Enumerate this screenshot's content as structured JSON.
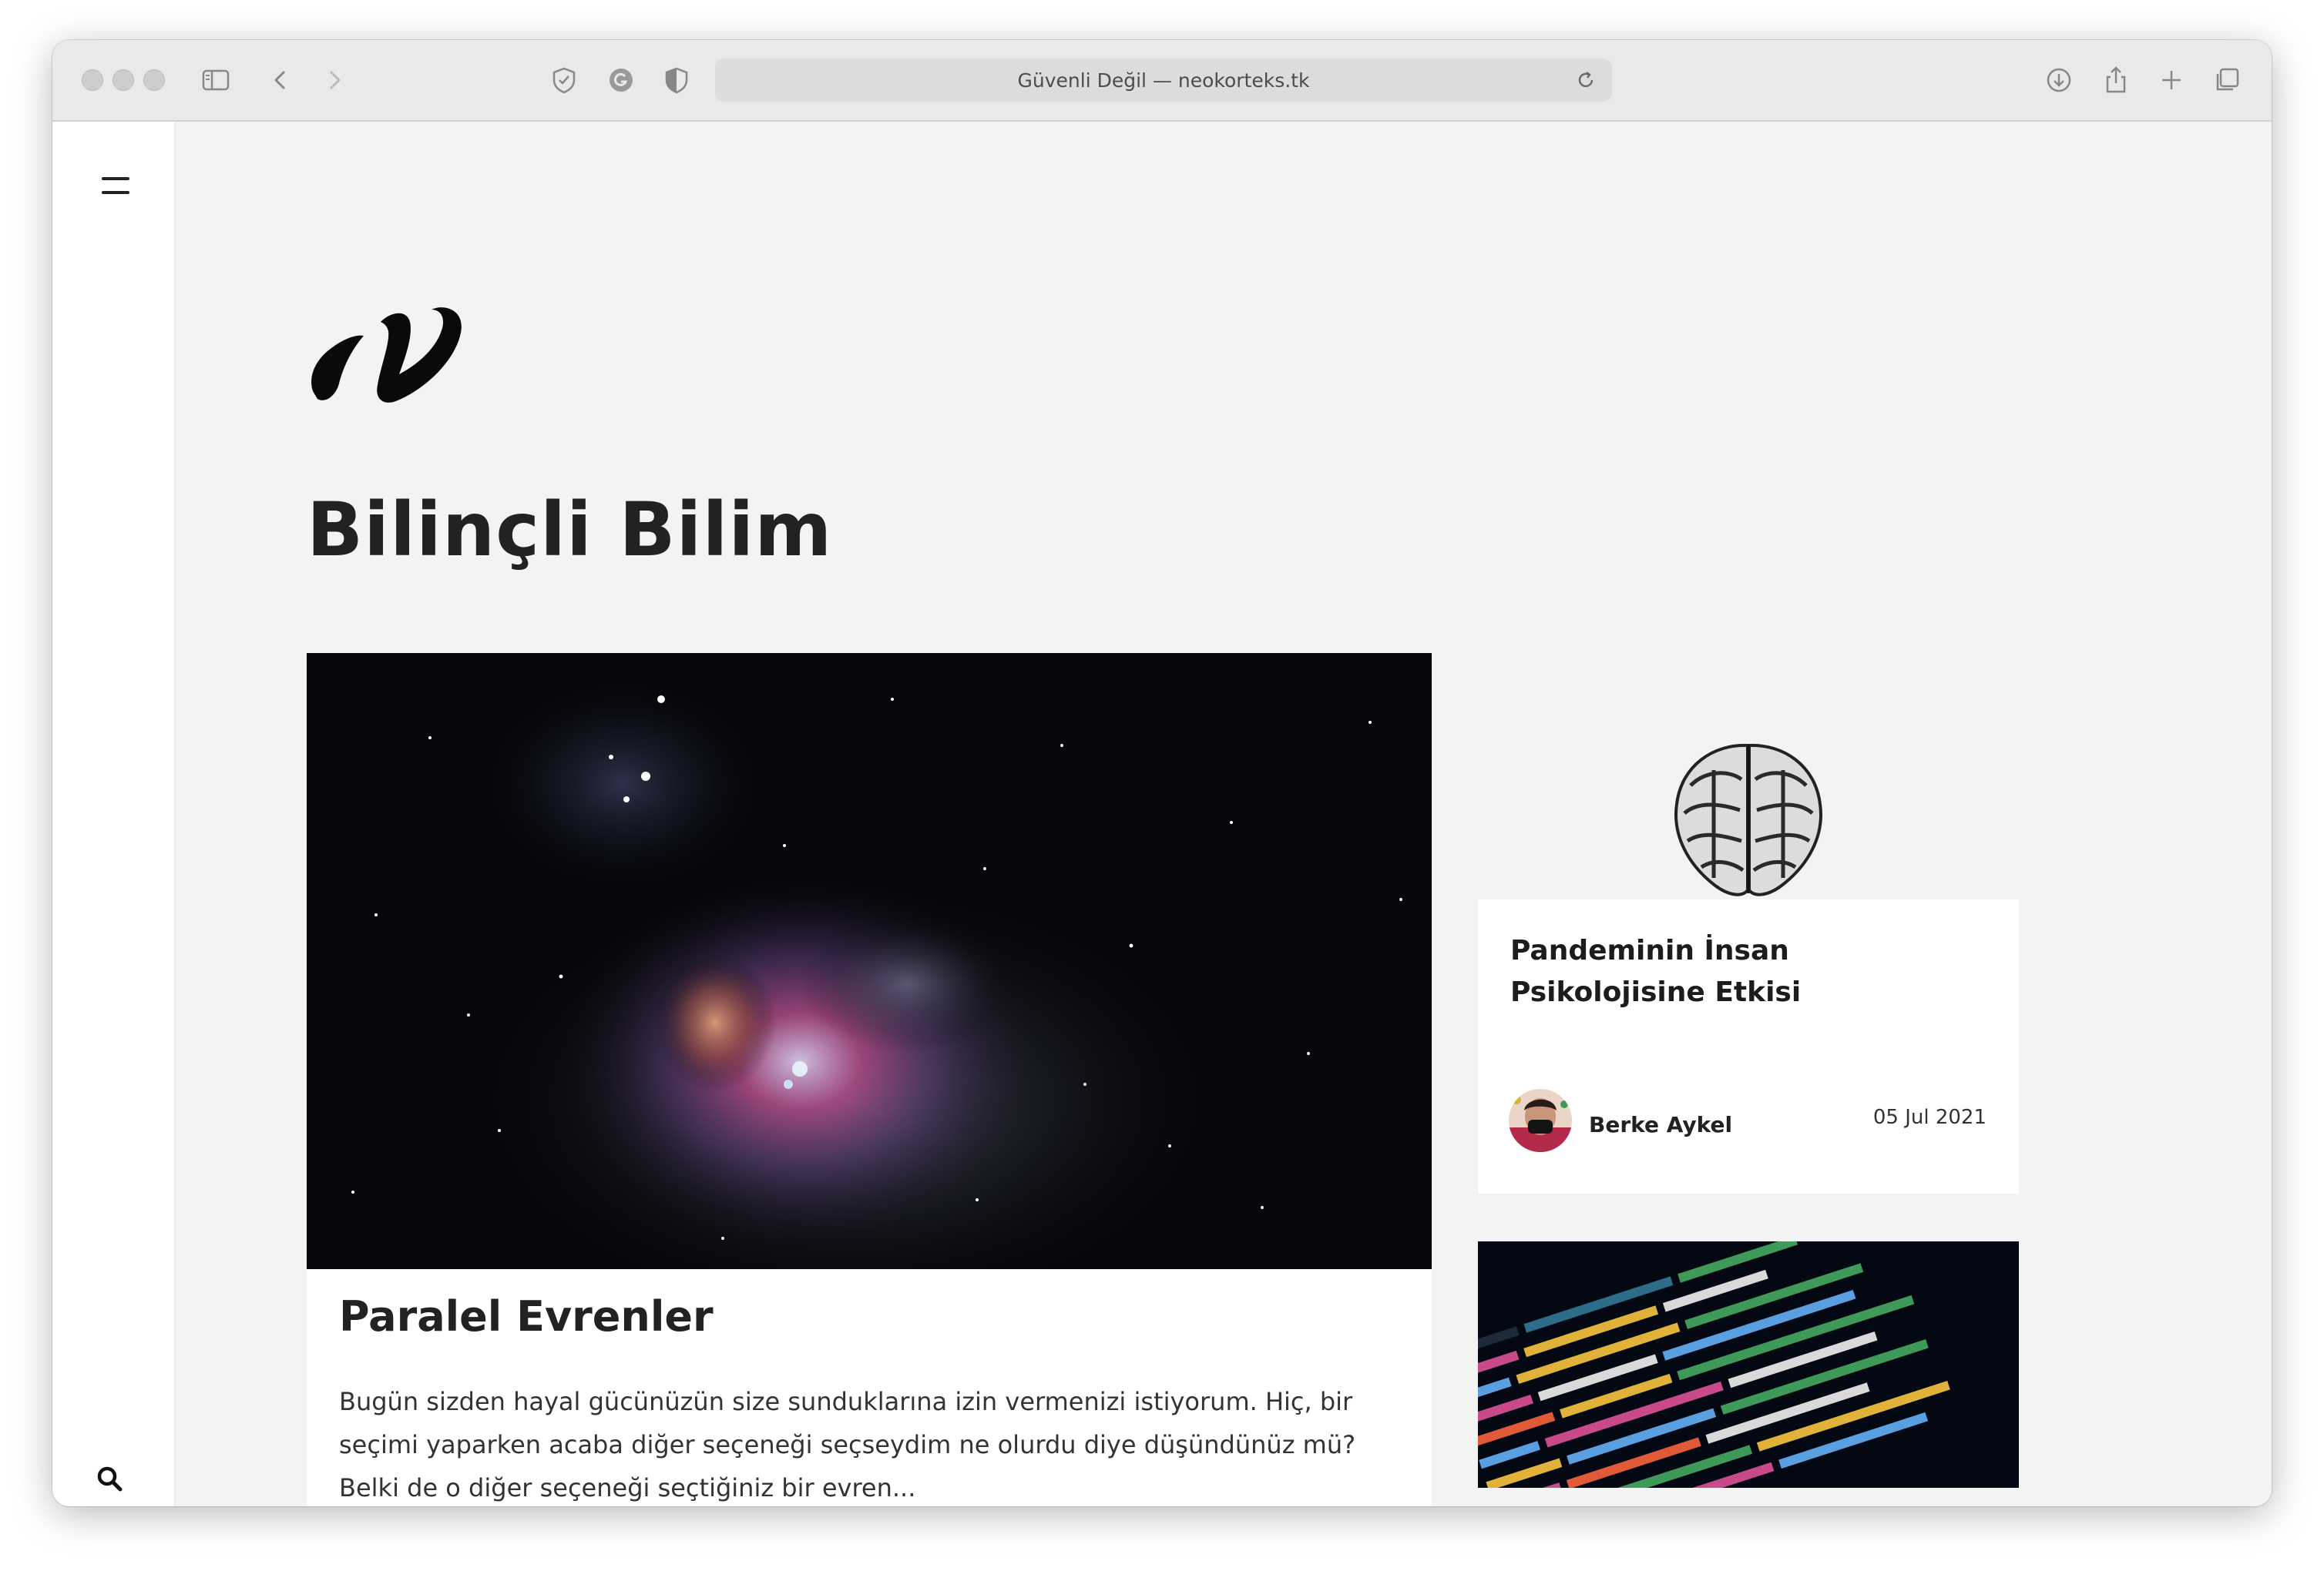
{
  "browser": {
    "url_text": "Güvenli Değil — neokorteks.tk"
  },
  "site": {
    "title": "Bilinçli Bilim"
  },
  "featured": {
    "title": "Paralel Evrenler",
    "excerpt": "Bugün sizden hayal gücünüzün size sundukları­na izin vermenizi istiyorum. Hiç, bir seçimi yaparken acaba diğer seçeneği seçseydim ne olurdu diye düşündünüz mü? Belki de o diğer seçeneği seçtiğiniz bir evren..."
  },
  "side_post": {
    "title": "Pandeminin İnsan Psikolojisine Etkisi",
    "author": "Berke Aykel",
    "date": "05 Jul 2021"
  },
  "colors": {
    "title_text": "#222222",
    "background": "#f3f3f3",
    "card": "#ffffff"
  }
}
